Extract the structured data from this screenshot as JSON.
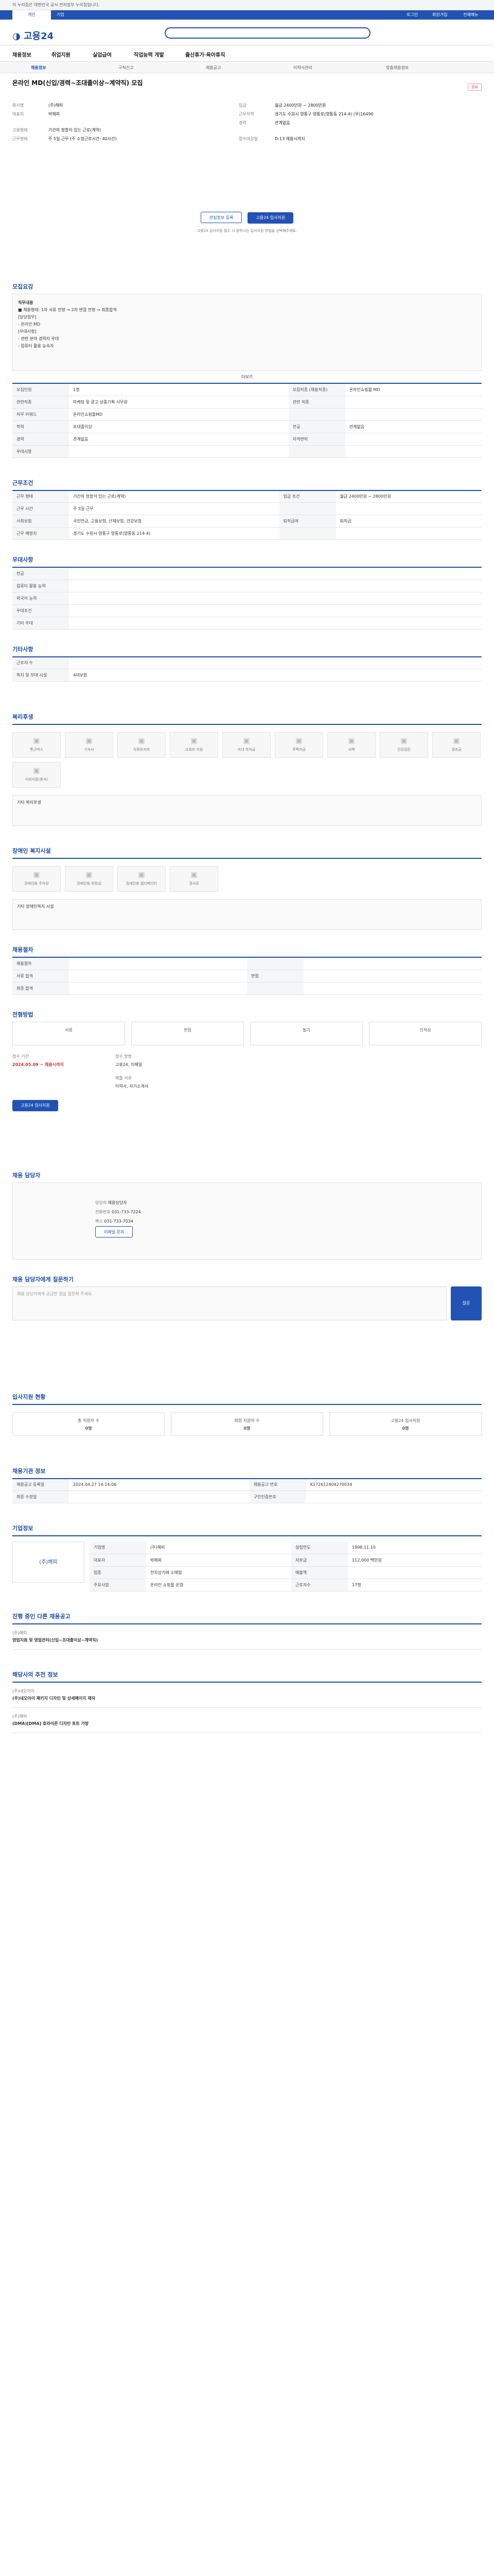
{
  "gov_banner": "이 누리집은 대한민국 공식 전자정부 누리집입니다.",
  "topnav": {
    "personal": "개인",
    "company": "기업",
    "login": "로그인",
    "signup": "회원가입",
    "all": "전체메뉴"
  },
  "logo": "고용24",
  "gnb_search_placeholder": "검색어를 입력하세요",
  "menu": [
    "채용정보",
    "취업지원",
    "실업급여",
    "직업능력 개발",
    "출산휴가·육아휴직"
  ],
  "subtabs": [
    "채용정보",
    "구직신고",
    "채용공고",
    "이력서관리",
    "맞춤채용정보"
  ],
  "job": {
    "title": "온라인 MD(신입/경력∼조대졸이상∼계약직) 모집",
    "share": "공유",
    "company_label": "회사명",
    "company": "(주)해피",
    "ceo_label": "대표자",
    "ceo": "박해피",
    "wage_label": "임금",
    "wage": "월급 2400만원 ∼ 2800만원",
    "place_label": "근무지역",
    "place": "경기도 수원시 영통구 영통로(영통동 214-4) (우)16490",
    "exp_label": "경력",
    "exp": "관계없음",
    "hire_label": "고용형태",
    "hire": "기간의 정함이 있는 근로(계약)",
    "work_label": "근무형태",
    "work": "주 5일 근무 (주 소정근로시간: 40시간)",
    "recv_label": "접수마감일",
    "recv": "D-13 채용시까지",
    "btn_save": "관심정보 등록",
    "btn_apply": "고용24 입사지원",
    "notice": "고용24 입사지원 접수 시 원하시는 입사지원 방법을 선택해주세요."
  },
  "section1": {
    "title": "모집요강",
    "desc_title": "직무내용",
    "desc": [
      "■ 채용형태: 1차 서류 전형 → 2차 면접 전형 → 최종합격",
      "[담당업무]",
      "- 온라인 MD",
      "[우대사항]",
      "- 관련 분야 경력자 우대",
      "- 컴퓨터 활용 능숙자"
    ],
    "more": "더보기",
    "rows": [
      [
        "모집인원",
        "1명",
        "모집직종 (채용직종)",
        "온라인쇼핑몰 MD"
      ],
      [
        "관련직종",
        "마케팅 및 광고 상품기획 사무원",
        "관련 직종",
        ""
      ],
      [
        "직무 키워드",
        "온라인쇼핑몰MD",
        "",
        ""
      ],
      [
        "학력",
        "조대졸이상",
        "전공",
        "관계없음"
      ],
      [
        "경력",
        "관계없음",
        "자격면허",
        ""
      ],
      [
        "우대사항",
        "",
        "",
        ""
      ]
    ]
  },
  "section2": {
    "title": "근무조건",
    "rows": [
      [
        "근무 형태",
        "기간의 정함이 있는 근로(계약)",
        "임금 조건",
        "월급 2400만원 ∼ 2800만원"
      ],
      [
        "근무 시간",
        "주 5일 근무",
        "",
        ""
      ],
      [
        "사회보험",
        "국민연금, 고용보험, 산재보험, 건강보험",
        "퇴직급여",
        "퇴직금"
      ],
      [
        "근무 예정지",
        "경기도 수원시 영통구 영통로(영통동 214-4)",
        "",
        ""
      ]
    ]
  },
  "section3": {
    "title": "우대사항",
    "rows": [
      [
        "전공",
        ""
      ],
      [
        "컴퓨터 활용 능력",
        ""
      ],
      [
        "외국어 능력",
        ""
      ],
      [
        "우대조건",
        ""
      ],
      [
        "기타 우대",
        ""
      ]
    ]
  },
  "section4": {
    "title": "기타사항",
    "rows": [
      [
        "근로자 수",
        ""
      ],
      [
        "복지 및 부대 시설",
        "4대보험"
      ]
    ]
  },
  "section5": {
    "title": "복리후생",
    "items": [
      "통근버스",
      "기숙사",
      "차량유지비",
      "교육비 지원",
      "자녀 학자금",
      "주택자금",
      "사택",
      "건강검진",
      "경조금",
      "식비지원(중식)"
    ],
    "etc": "기타 복리후생"
  },
  "section6": {
    "title": "장애인 복지시설",
    "items": [
      "장애인용 주차장",
      "장애인용 화장실",
      "장애인용 엘리베이터",
      "경사로"
    ],
    "etc": "기타 장애인복지 시설"
  },
  "section7": {
    "title": "채용절차",
    "rows": [
      [
        "채용절차",
        "",
        "",
        ""
      ],
      [
        "서류 합격",
        "",
        "면접",
        ""
      ],
      [
        "최종 합격",
        "",
        "",
        ""
      ]
    ]
  },
  "section8": {
    "title": "전형방법",
    "steps": [
      "서류",
      "면접",
      "필기",
      "인적성"
    ],
    "recv_period_label": "접수 기간",
    "recv_period": "2024.05.09 ∼ 채용시까지",
    "method_label": "접수 방법",
    "method": "고용24, 이메일",
    "doc_label": "제출 서류",
    "doc": "이력서, 자기소개서",
    "btn": "고용24 입사지원"
  },
  "section9": {
    "title": "채용 담당자",
    "name_label": "담당자",
    "name": "채용담당자",
    "tel_label": "전화번호",
    "tel": "031-733-7224",
    "fax_label": "팩스",
    "fax": "031-733-7034",
    "email_btn": "이메일 문의"
  },
  "faq": {
    "title": "채용 담당자에게 질문하기",
    "placeholder": "채용 담당자에게 궁금한 점을 질문해 주세요.",
    "btn": "질문"
  },
  "section10": {
    "title": "입사지원 현황",
    "cards": [
      [
        "총 지원자 수",
        "0명"
      ],
      [
        "회원 지원자 수",
        "0명"
      ],
      [
        "고용24 입사지원",
        "0명"
      ]
    ]
  },
  "section11": {
    "title": "채용기관 정보",
    "rows": [
      [
        "채용공고 등록일",
        "2024.04.27 14:14:06",
        "채용공고 번호",
        "K172612404270034"
      ],
      [
        "최종 수정일",
        "",
        "구인인증번호",
        ""
      ]
    ]
  },
  "section12": {
    "title": "기업정보",
    "company": "(주)해피",
    "rows": [
      [
        "기업명",
        "(주)해피",
        "설립연도",
        "1998.11.10"
      ],
      [
        "대표자",
        "박해피",
        "자본금",
        "112,000 백만원"
      ],
      [
        "업종",
        "전자상거래 소매업",
        "매출액",
        ""
      ],
      [
        "주요사업",
        "온라인 쇼핑몰 운영",
        "근로자수",
        "17명"
      ]
    ]
  },
  "section13": {
    "title": "진행 중인 다른 채용공고",
    "items": [
      [
        "(주)해피",
        "영업지원 및 영업관리(신입∼조대졸이상∼계약직)"
      ]
    ]
  },
  "section14": {
    "title": "해당사의 추천 정보",
    "items": [
      [
        "(주)네오아이",
        "(주)네오아이 패키지 디자인 및 상세페이지 제작"
      ],
      [
        "(주)해피",
        "(DMA)[DMA] 호라이즌 디자인 토트 가방"
      ]
    ]
  },
  "colors": {
    "primary": "#2252b3",
    "accent": "#1e4fa6",
    "warn": "#c33"
  }
}
